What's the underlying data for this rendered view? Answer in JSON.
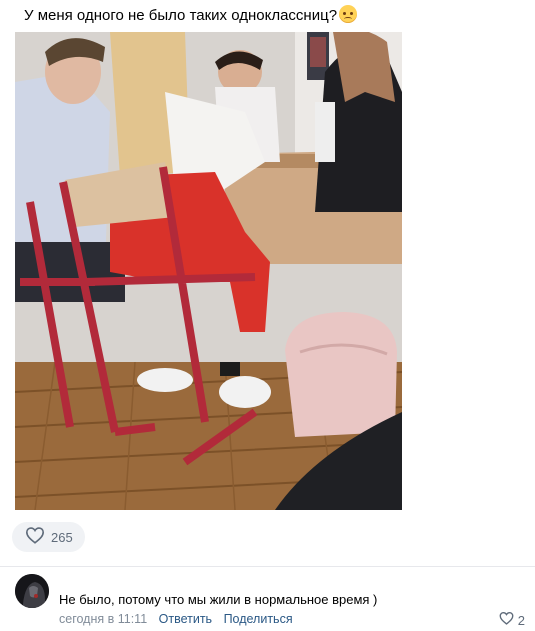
{
  "post": {
    "text": "У меня одного не было таких одноклассниц?",
    "emoji": "worried-face-emoji"
  },
  "likes": {
    "icon": "heart-icon",
    "count": "265"
  },
  "comment": {
    "text": "Не было, потому что мы жили в нормальное время )",
    "time": "сегодня в 11:11",
    "reply_label": "Ответить",
    "share_label": "Поделиться",
    "like_icon": "heart-icon",
    "like_count": "2"
  },
  "colors": {
    "link": "#2a5885",
    "meta": "#818c99",
    "pill_bg": "#f0f2f5",
    "icon_gray": "#5f6b7a"
  }
}
